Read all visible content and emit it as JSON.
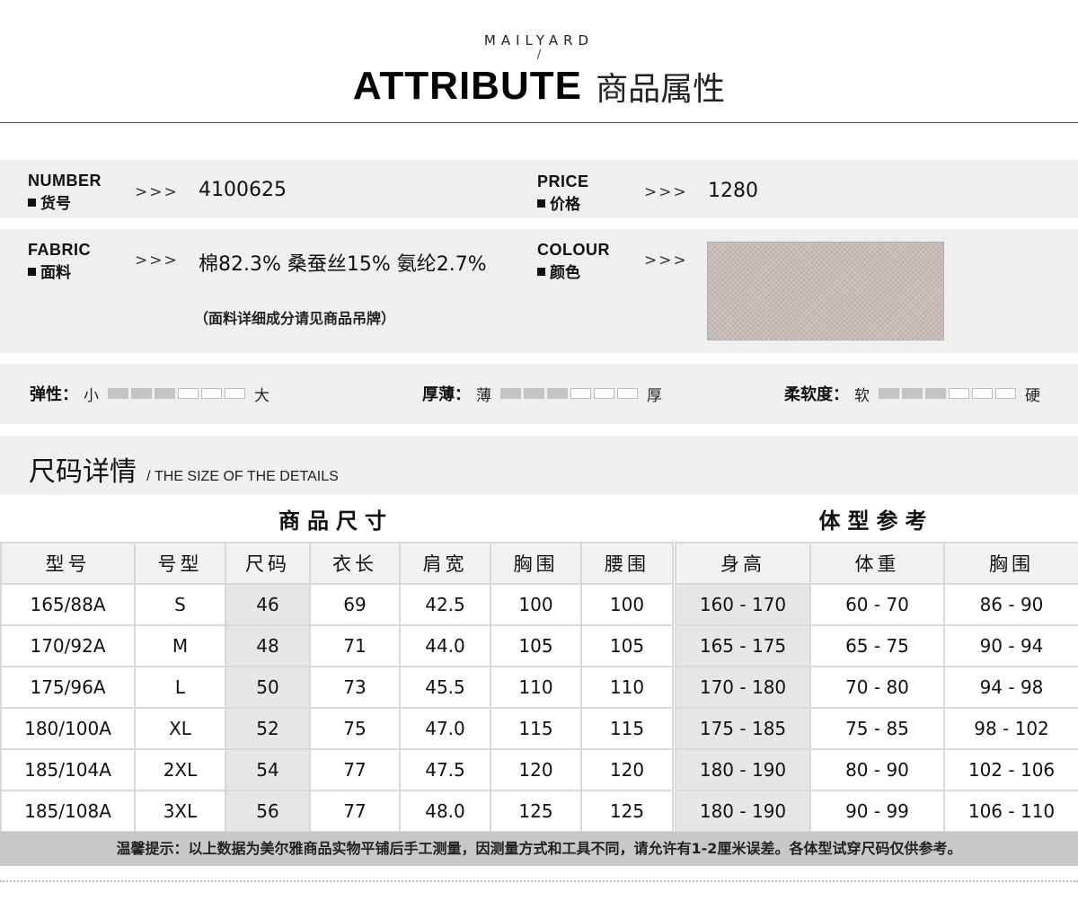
{
  "header": {
    "brand": "MAILYARD",
    "slash": "/",
    "title_en": "ATTRIBUTE",
    "title_cn": "商品属性"
  },
  "attributes": {
    "number": {
      "label_en": "NUMBER",
      "label_cn": "货号",
      "arrow": ">>>",
      "value": "4100625"
    },
    "price": {
      "label_en": "PRICE",
      "label_cn": "价格",
      "arrow": ">>>",
      "value": "1280"
    },
    "fabric": {
      "label_en": "FABRIC",
      "label_cn": "面料",
      "arrow": ">>>",
      "value": "棉82.3% 桑蚕丝15% 氨纶2.7%",
      "note": "（面料详细成分请见商品吊牌）"
    },
    "colour": {
      "label_en": "COLOUR",
      "label_cn": "颜色",
      "arrow": ">>>",
      "swatch_color": "#c7bdb6"
    }
  },
  "scales": [
    {
      "name": "弹性：",
      "low": "小",
      "high": "大",
      "filled": 3,
      "total": 6
    },
    {
      "name": "厚薄：",
      "low": "薄",
      "high": "厚",
      "filled": 3,
      "total": 6
    },
    {
      "name": "柔软度：",
      "low": "软",
      "high": "硬",
      "filled": 3,
      "total": 6
    }
  ],
  "size_section": {
    "title_cn": "尺码详情",
    "title_en": "/ THE SIZE OF THE DETAILS",
    "product_size_title": "商品尺寸",
    "body_ref_title": "体型参考"
  },
  "product_table": {
    "headers": [
      "型号",
      "号型",
      "尺码",
      "衣长",
      "肩宽",
      "胸围",
      "腰围"
    ],
    "rows": [
      [
        "165/88A",
        "S",
        "46",
        "69",
        "42.5",
        "100",
        "100"
      ],
      [
        "170/92A",
        "M",
        "48",
        "71",
        "44.0",
        "105",
        "105"
      ],
      [
        "175/96A",
        "L",
        "50",
        "73",
        "45.5",
        "110",
        "110"
      ],
      [
        "180/100A",
        "XL",
        "52",
        "75",
        "47.0",
        "115",
        "115"
      ],
      [
        "185/104A",
        "2XL",
        "54",
        "77",
        "47.5",
        "120",
        "120"
      ],
      [
        "185/108A",
        "3XL",
        "56",
        "77",
        "48.0",
        "125",
        "125"
      ]
    ]
  },
  "body_table": {
    "headers": [
      "身高",
      "体重",
      "胸围"
    ],
    "rows": [
      [
        "160 - 170",
        "60 - 70",
        "86 - 90"
      ],
      [
        "165 - 175",
        "65 - 75",
        "90 - 94"
      ],
      [
        "170 - 180",
        "70 - 80",
        "94 - 98"
      ],
      [
        "175 - 185",
        "75 - 85",
        "98 - 102"
      ],
      [
        "180 - 190",
        "80 - 90",
        "102 - 106"
      ],
      [
        "180 - 190",
        "90 - 99",
        "106 - 110"
      ]
    ]
  },
  "bottom_note": "温馨提示：以上数据为美尔雅商品实物平铺后手工测量，因测量方式和工具不同，请允许有1-2厘米误差。各体型试穿尺码仅供参考。"
}
